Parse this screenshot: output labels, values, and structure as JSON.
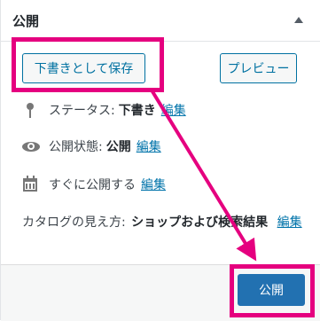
{
  "panel": {
    "title": "公開",
    "toggle_icon": "triangle-up-icon"
  },
  "buttons": {
    "save_draft": "下書きとして保存",
    "preview": "プレビュー",
    "publish": "公開"
  },
  "status": {
    "icon": "pin-icon",
    "label": "ステータス:",
    "value": "下書き",
    "edit": "編集"
  },
  "visibility": {
    "icon": "eye-icon",
    "label": "公開状態:",
    "value": "公開",
    "edit": "編集"
  },
  "schedule": {
    "icon": "calendar-icon",
    "label": "すぐに公開する",
    "edit": "編集"
  },
  "catalog": {
    "label": "カタログの見え方:",
    "value": "ショップおよび検索結果",
    "edit": "編集"
  },
  "annotation": {
    "highlight_color": "#e5007f"
  }
}
